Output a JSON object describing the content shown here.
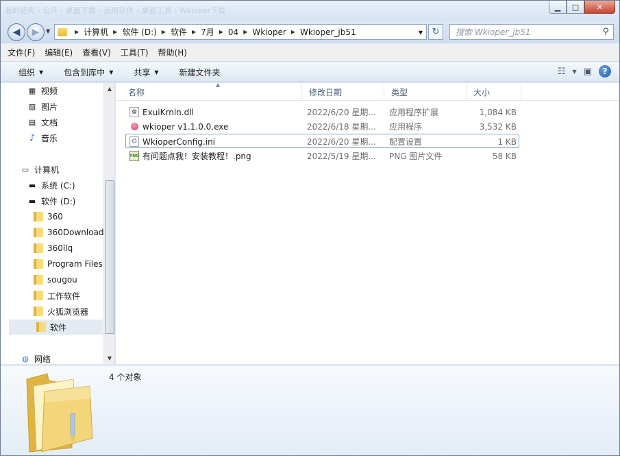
{
  "window": {
    "title_ghost": "我的经典 › 公开 › 桌面下载 › 运用软件 › 桌面工具 › Wkioper下载",
    "minimize_icon": "minimize-icon",
    "maximize_icon": "maximize-icon",
    "close_icon": "close-icon"
  },
  "address": {
    "crumbs": [
      "计算机",
      "软件 (D:)",
      "软件",
      "7月",
      "04",
      "Wkioper",
      "Wkioper_jb51"
    ],
    "search_placeholder": "搜索 Wkioper_jb51"
  },
  "menubar": {
    "items": [
      "文件(F)",
      "编辑(E)",
      "查看(V)",
      "工具(T)",
      "帮助(H)"
    ]
  },
  "toolbar": {
    "organize": "组织",
    "include_library": "包含到库中",
    "share": "共享",
    "new_folder": "新建文件夹"
  },
  "nav": {
    "items": [
      "视频",
      "图片",
      "文档",
      "音乐",
      "计算机",
      "系统 (C:)",
      "软件 (D:)",
      "360",
      "360Download",
      "360llq",
      "Program Files",
      "sougou",
      "工作软件",
      "火狐浏览器",
      "软件",
      "网络"
    ],
    "selected": "软件"
  },
  "columns": {
    "name": "名称",
    "modified": "修改日期",
    "type": "类型",
    "size": "大小"
  },
  "files": [
    {
      "name": "ExuiKrnln.dll",
      "modified": "2022/6/20 星期...",
      "type": "应用程序扩展",
      "size": "1,084 KB",
      "icon": "dll-icon"
    },
    {
      "name": "wkioper v1.1.0.0.exe",
      "modified": "2022/6/18 星期...",
      "type": "应用程序",
      "size": "3,532 KB",
      "icon": "exe-icon"
    },
    {
      "name": "WkioperConfig.ini",
      "modified": "2022/6/20 星期...",
      "type": "配置设置",
      "size": "1 KB",
      "icon": "ini-icon"
    },
    {
      "name": "有问题点我！安装教程！.png",
      "modified": "2022/5/19 星期...",
      "type": "PNG 图片文件",
      "size": "58 KB",
      "icon": "png-icon"
    }
  ],
  "details": {
    "count": "4 个对象"
  }
}
